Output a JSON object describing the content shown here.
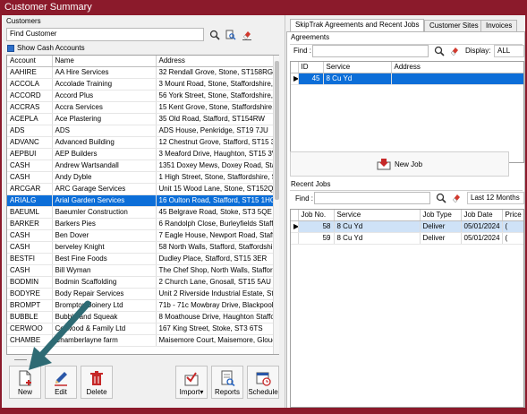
{
  "window": {
    "title": "Customer Summary"
  },
  "customers": {
    "section_label": "Customers",
    "find_placeholder": "Find Customer",
    "show_cash_label": "Show Cash Accounts",
    "show_cash_checked": true,
    "columns": [
      "Account",
      "Name",
      "Address"
    ],
    "rows": [
      [
        "AAHIRE",
        "AA Hire Services",
        "32 Rendall Grove, Stone, ST158RG"
      ],
      [
        "ACCOLA",
        "Accolade Training",
        "3 Mount Road, Stone, Staffordshire, S"
      ],
      [
        "ACCORD",
        "Accord Plus",
        "56 York Street, Stone, Staffordshire, S"
      ],
      [
        "ACCRAS",
        "Accra Services",
        "15 Kent Grove, Stone, Staffordshire, S"
      ],
      [
        "ACEPLA",
        "Ace Plastering",
        "35 Old Road, Stafford, ST154RW"
      ],
      [
        "ADS",
        "ADS",
        "ADS House, Penkridge, ST19 7JU"
      ],
      [
        "ADVANC",
        "Advanced Building",
        "12 Chestnut Grove, Stafford, ST15 3("
      ],
      [
        "AEPBUI",
        "AEP Builders",
        "3 Meaford Drive, Haughton, ST15 3V"
      ],
      [
        "CASH",
        "Andrew Wartsandall",
        "1351 Doxey Mews, Doxey Road, Staff"
      ],
      [
        "CASH",
        "Andy Dyble",
        "1 High Street, Stone, Staffordshire, ST"
      ],
      [
        "ARCGAR",
        "ARC Garage Services",
        "Unit 15 Wood Lane, Stone, ST152QR"
      ],
      [
        "ARIALG",
        "Arial Garden Services",
        "16 Oulton Road, Stafford, ST15 1HG"
      ],
      [
        "BAEUML",
        "Baeumler Construction",
        "45 Belgrave Road, Stoke, ST3 5QE"
      ],
      [
        "BARKER",
        "Barkers Pies",
        "6 Randolph Close, Burleyfields Staffo"
      ],
      [
        "CASH",
        "Ben Dover",
        "7 Eagle House, Newport Road, Staffo"
      ],
      [
        "CASH",
        "berveley Knight",
        "58 North Walls, Stafford, Staffordshire"
      ],
      [
        "BESTFI",
        "Best Fine Foods",
        "Dudley Place, Stafford, ST15 3ER"
      ],
      [
        "CASH",
        "Bill Wyman",
        "The Chef Shop, North Walls, Stafford"
      ],
      [
        "BODMIN",
        "Bodmin Scaffolding",
        "2 Church Lane, Gnosall, ST15 5AU"
      ],
      [
        "BODYRE",
        "Body Repair Services",
        "Unit 2 Riverside Industrial Estate, Sta"
      ],
      [
        "BROMPT",
        "Brompton Joinery Ltd",
        "71b - 71c Mowbray Drive, Blackpool"
      ],
      [
        "BUBBLE",
        "Bubble and Squeak",
        "8 Moathouse Drive, Haughton Staffor"
      ],
      [
        "CERWOO",
        "Cerwood & Family Ltd",
        "167 King Street, Stoke, ST3 6TS"
      ],
      [
        "CHAMBE",
        "Chamberlayne farm",
        "Maisemore Court, Maisemore, Glouc"
      ]
    ],
    "selected_account": "ARIALG",
    "buttons": {
      "new": "New",
      "edit": "Edit",
      "delete": "Delete",
      "import": "Import",
      "reports": "Reports",
      "schedule": "Schedule"
    }
  },
  "right": {
    "tabs": [
      "SkipTrak Agreements and Recent Jobs",
      "Customer Sites",
      "Invoices"
    ],
    "agreements": {
      "title": "Agreements",
      "find_label": "Find :",
      "display_label": "Display:",
      "display_value": "ALL",
      "columns": [
        "ID",
        "Service",
        "Address"
      ],
      "rows": [
        [
          "45",
          "8 Cu Yd",
          ""
        ]
      ]
    },
    "new_job_label": "New Job",
    "recent_jobs": {
      "title": "Recent Jobs",
      "find_label": "Find :",
      "period_value": "Last 12 Months",
      "columns": [
        "Job No.",
        "Service",
        "Job Type",
        "Job Date",
        "Price"
      ],
      "rows": [
        [
          "58",
          "8 Cu Yd",
          "Deliver",
          "05/01/2024",
          "("
        ],
        [
          "59",
          "8 Cu Yd",
          "Deliver",
          "05/01/2024",
          "("
        ]
      ]
    }
  },
  "colors": {
    "accent": "#8b1a2b",
    "selection": "#0c6ed8",
    "arrow": "#2e6b74"
  }
}
